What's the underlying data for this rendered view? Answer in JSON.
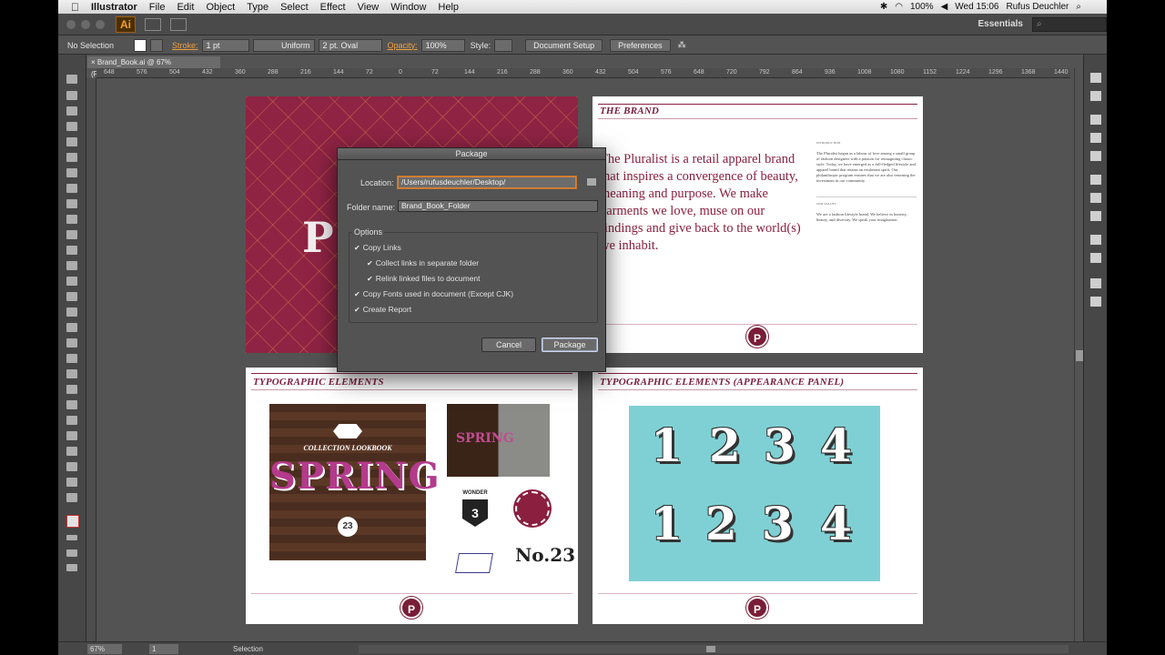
{
  "menubar": {
    "apple": "",
    "items": [
      "Illustrator",
      "File",
      "Edit",
      "Object",
      "Type",
      "Select",
      "Effect",
      "View",
      "Window",
      "Help"
    ],
    "battery": "100%",
    "clock": "Wed 15:06",
    "user": "Rufus Deuchler"
  },
  "appbar": {
    "logo": "Ai",
    "workspace": "Essentials",
    "search_placeholder": ""
  },
  "controlbar": {
    "selection": "No Selection",
    "stroke_label": "Stroke:",
    "stroke_weight": "1 pt",
    "profile": "Uniform",
    "brush": "2 pt. Oval",
    "opacity_label": "Opacity:",
    "opacity_value": "100%",
    "style_label": "Style:",
    "document_setup": "Document Setup",
    "preferences": "Preferences"
  },
  "document": {
    "tab": "Brand_Book.ai @ 67% (RGB/Preview)"
  },
  "ruler_ticks": [
    "648",
    "576",
    "504",
    "432",
    "360",
    "288",
    "216",
    "144",
    "72",
    "0",
    "72",
    "144",
    "216",
    "288",
    "360",
    "432",
    "504",
    "576",
    "648",
    "720",
    "792",
    "864",
    "936",
    "1008",
    "1080",
    "1152",
    "1224",
    "1296",
    "1368",
    "1440"
  ],
  "artboards": {
    "cover_letter": "P",
    "brand": {
      "title": "THE BRAND",
      "lead": "The Pluralist is a retail apparel brand that inspires a convergence of beauty, meaning and purpose. We make garments we love, muse on our findings and give back to the world(s) we inhabit.",
      "col_heading": "INTRODUCTION",
      "col_text": "The Pluralist began as a labour of love among a small group of fashion designers with a passion for reimagining classic style. Today, we have emerged as a full-fledged lifestyle and apparel brand that retains an exuberant spirit. Our philanthropic program ensures that we are also returning the investment in our community.",
      "col_heading2": "OUR VALUES",
      "col_text2": "We are a fashion lifestyle brand. We believe in honesty, beauty, and diversity. We speak your imagination.",
      "badge": "P"
    },
    "typographic": {
      "title": "TYPOGRAPHIC ELEMENTS",
      "collection": "COLLECTION LOOKBOOK",
      "spring": "SPRING",
      "number": "23",
      "photo_word": "SPRING",
      "wonder": "WONDER",
      "wonder_num": "3",
      "no23": "No.23",
      "badge": "P"
    },
    "appearance": {
      "title": "TYPOGRAPHIC ELEMENTS (APPEARANCE PANEL)",
      "digits_top": [
        "1",
        "2",
        "3",
        "4"
      ],
      "digits_bottom": [
        "1",
        "2",
        "3",
        "4"
      ],
      "badge": "P"
    }
  },
  "dialog": {
    "title": "Package",
    "location_label": "Location:",
    "location_value": "/Users/rufusdeuchler/Desktop/",
    "folder_label": "Folder name:",
    "folder_value": "Brand_Book_Folder",
    "options_label": "Options",
    "options": [
      {
        "label": "Copy Links",
        "checked": true
      },
      {
        "label": "Collect links in separate folder",
        "checked": true
      },
      {
        "label": "Relink linked files to document",
        "checked": true
      },
      {
        "label": "Copy Fonts used in document (Except CJK)",
        "checked": true
      },
      {
        "label": "Create Report",
        "checked": true
      }
    ],
    "check_glyph": "✔",
    "cancel": "Cancel",
    "package": "Package"
  },
  "statusbar": {
    "zoom": "67%",
    "page": "1",
    "tool": "Selection"
  }
}
